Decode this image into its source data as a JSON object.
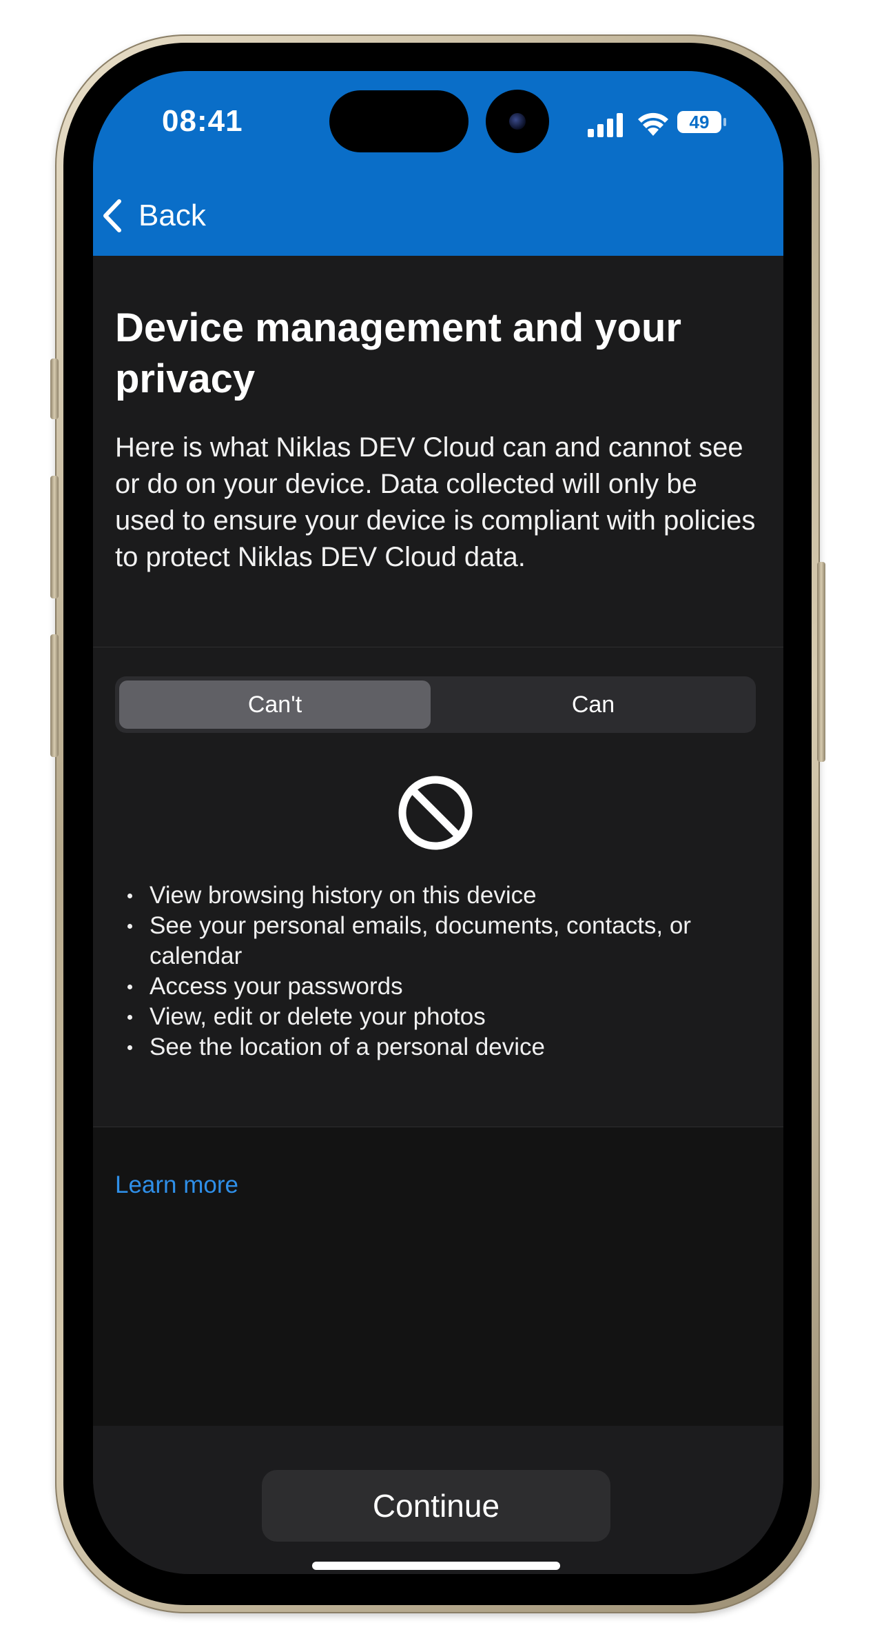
{
  "status_bar": {
    "time": "08:41",
    "battery": "49",
    "icons": [
      "cellular-signal-icon",
      "wifi-icon",
      "battery-icon"
    ]
  },
  "nav": {
    "back_label": "Back"
  },
  "page": {
    "title": "Device management and your privacy",
    "description": "Here is what Niklas DEV Cloud can and cannot see or do on your device. Data collected will only be used to ensure your device is compliant with policies to protect Niklas DEV Cloud data."
  },
  "segmented_control": {
    "options": [
      "Can't",
      "Can"
    ],
    "selected": "Can't"
  },
  "cant_list": {
    "icon": "prohibited-icon",
    "items": [
      "View browsing history on this device",
      "See your personal emails, documents, contacts, or calendar",
      "Access your passwords",
      "View, edit or delete your photos",
      "See the location of a personal device"
    ]
  },
  "links": {
    "learn_more": "Learn more"
  },
  "footer": {
    "continue_label": "Continue"
  },
  "colors": {
    "header_blue": "#0a6ec8",
    "link_blue": "#2f8fe8",
    "background": "#1b1b1c"
  }
}
